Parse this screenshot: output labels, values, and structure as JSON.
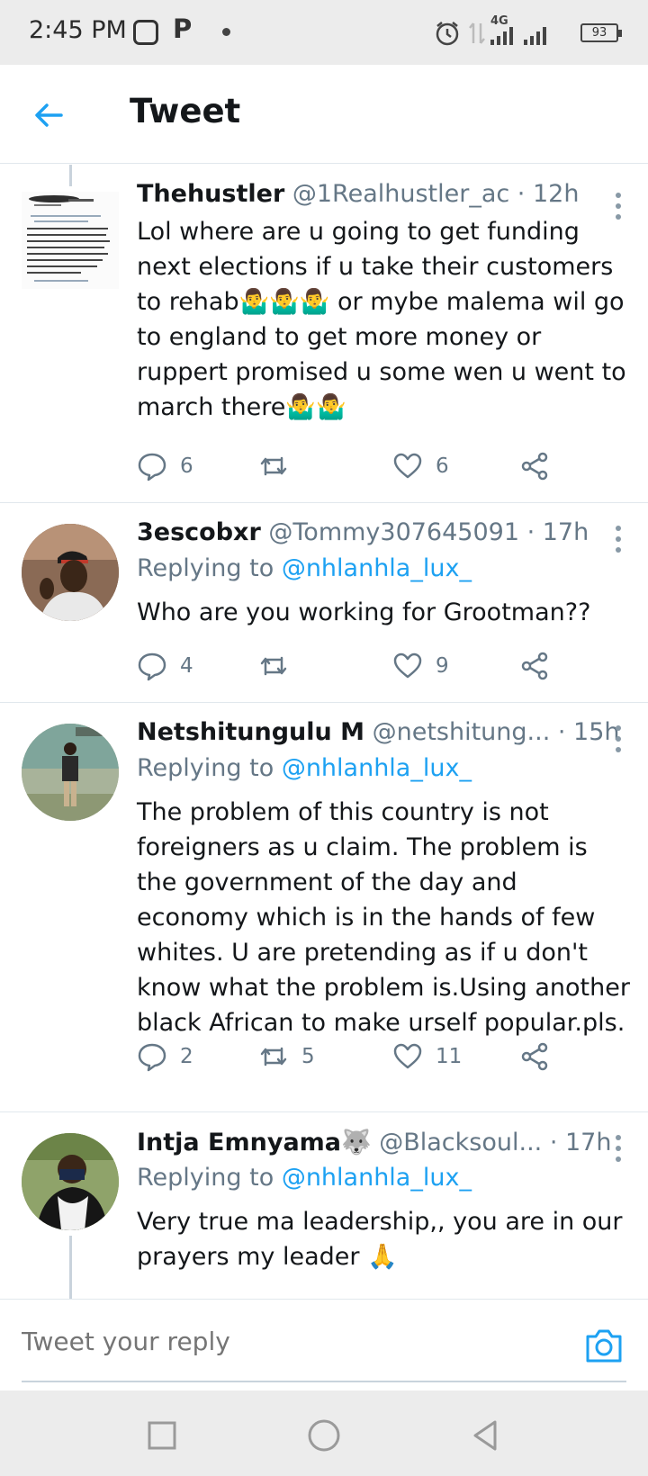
{
  "status_bar": {
    "time": "2:45 PM",
    "notification_icons": [
      "app-icon",
      "p-icon",
      "dot"
    ],
    "network": "4G",
    "battery": "93"
  },
  "header": {
    "title": "Tweet",
    "back_icon": "arrow-left-icon"
  },
  "tweets": [
    {
      "name": "Thehustler",
      "handle": "@1Realhustler_ac · 12h",
      "text": "Lol where are u going to get funding next elections if u take their customers to rehab🤷‍♂️🤷‍♂️🤷‍♂️ or mybe malema wil go to england to get more money or ruppert promised u some wen u went to march there🤷‍♂️🤷‍♂️",
      "replies": "6",
      "retweets": "",
      "likes": "6"
    },
    {
      "name": "3escobxr",
      "handle": "@Tommy307645091 · 17h",
      "replying_label": "Replying to",
      "replying_to": "@nhlanhla_lux_",
      "text": "Who are you working for Grootman??",
      "replies": "4",
      "retweets": "",
      "likes": "9"
    },
    {
      "name": "Netshitungulu M",
      "handle": "@netshitung... · 15h",
      "replying_label": "Replying to",
      "replying_to": "@nhlanhla_lux_",
      "text": "The problem of this country is not foreigners as u claim. The problem is the government of the day and economy which is in the hands of few whites. U are pretending as if u don't know what the problem is.Using another black African to make urself popular.pls.",
      "replies": "2",
      "retweets": "5",
      "likes": "11"
    },
    {
      "name": "Intja Emnyama🐺",
      "handle": "@Blacksoul... · 17h",
      "replying_label": "Replying to",
      "replying_to": "@nhlanhla_lux_",
      "text": "Very true ma leadership,, you are in our prayers my leader 🙏"
    }
  ],
  "reply_bar": {
    "placeholder": "Tweet your reply",
    "camera_icon": "camera-icon"
  },
  "nav_bar": {
    "buttons": [
      "recents-square-icon",
      "home-circle-icon",
      "back-triangle-icon"
    ]
  },
  "colors": {
    "accent": "#1da1f2",
    "secondary_text": "#657786",
    "divider": "#e1e8ed"
  }
}
